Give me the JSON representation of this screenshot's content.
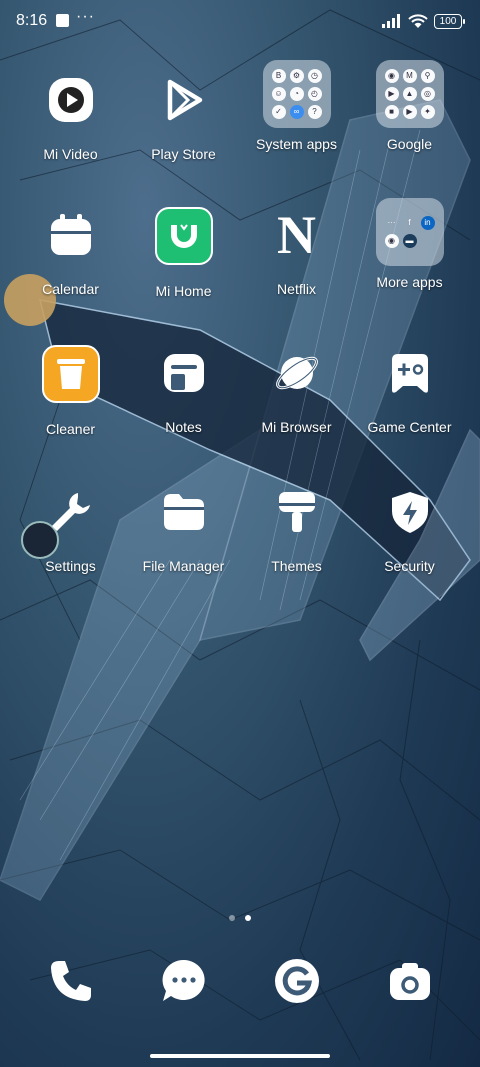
{
  "status": {
    "time": "8:16",
    "battery": "100"
  },
  "apps": [
    {
      "label": "Mi Video",
      "icon": "play-circle-icon"
    },
    {
      "label": "Play Store",
      "icon": "play-triangle-icon"
    },
    {
      "label": "System apps",
      "icon": "folder-icon"
    },
    {
      "label": "Google",
      "icon": "folder-icon"
    },
    {
      "label": "Calendar",
      "icon": "calendar-icon"
    },
    {
      "label": "Mi Home",
      "icon": "mi-home-icon"
    },
    {
      "label": "Netflix",
      "icon": "netflix-n-icon"
    },
    {
      "label": "More apps",
      "icon": "folder-icon"
    },
    {
      "label": "Cleaner",
      "icon": "trash-bin-icon"
    },
    {
      "label": "Notes",
      "icon": "notes-icon"
    },
    {
      "label": "Mi Browser",
      "icon": "planet-icon"
    },
    {
      "label": "Game Center",
      "icon": "gamepad-icon"
    },
    {
      "label": "Settings",
      "icon": "wrench-icon"
    },
    {
      "label": "File Manager",
      "icon": "folder-icon"
    },
    {
      "label": "Themes",
      "icon": "paint-brush-icon"
    },
    {
      "label": "Security",
      "icon": "shield-bolt-icon"
    }
  ],
  "dock": [
    {
      "icon": "phone-icon"
    },
    {
      "icon": "message-icon"
    },
    {
      "icon": "google-icon"
    },
    {
      "icon": "camera-icon"
    }
  ],
  "pages": {
    "count": 2,
    "current": 2
  },
  "colors": {
    "accent_green": "#1fbf73",
    "cleaner_orange": "#f5a623"
  }
}
